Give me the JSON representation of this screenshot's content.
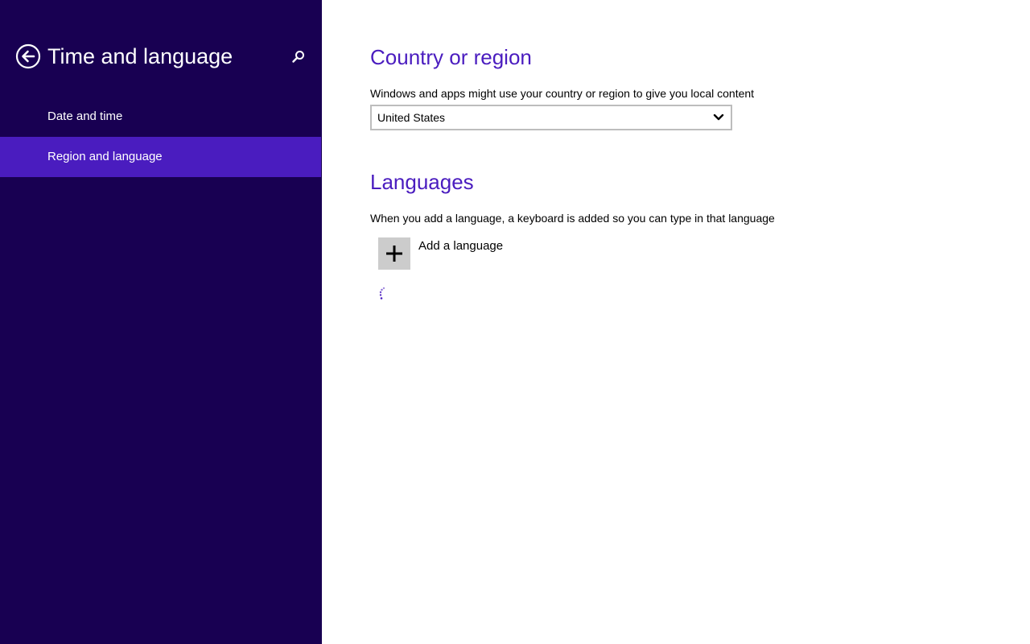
{
  "nav": {
    "title": "Time and language",
    "back_icon": "back-arrow-circle-icon",
    "search_icon": "search-icon",
    "items": [
      {
        "label": "Date and time",
        "selected": false
      },
      {
        "label": "Region and language",
        "selected": true
      }
    ]
  },
  "country": {
    "heading": "Country or region",
    "description": "Windows and apps might use your country or region to give you local content",
    "selected": "United States"
  },
  "languages": {
    "heading": "Languages",
    "description": "When you add a language, a keyboard is added so you can type in that language",
    "add_label": "Add a language",
    "loading": true
  },
  "colors": {
    "nav_background": "#180052",
    "accent": "#4a1cbf",
    "add_tile": "#cccccc"
  }
}
